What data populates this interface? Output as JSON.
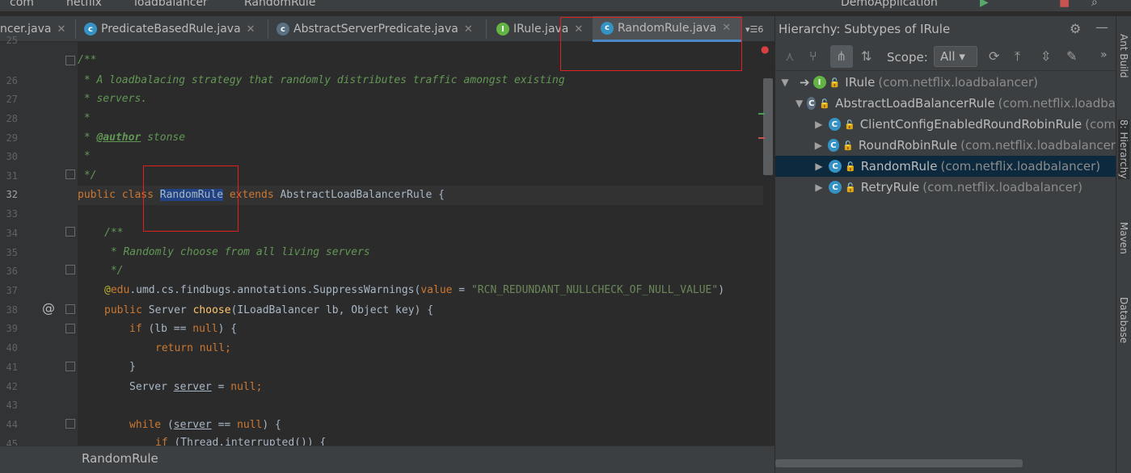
{
  "breadcrumbs": [
    "com",
    "netflix",
    "loadbalancer",
    "RandomRule"
  ],
  "run_config": "DemoApplication",
  "tabs": [
    {
      "label": "ncer.java",
      "icon": "class-icon"
    },
    {
      "label": "PredicateBasedRule.java",
      "icon": "class-icon"
    },
    {
      "label": "AbstractServerPredicate.java",
      "icon": "abstract-class-icon"
    },
    {
      "label": "IRule.java",
      "icon": "interface-icon"
    },
    {
      "label": "RandomRule.java",
      "icon": "class-icon",
      "active": true
    }
  ],
  "tab_overflow": "6",
  "editor": {
    "line_numbers": [
      "25",
      "26",
      "27",
      "28",
      "29",
      "30",
      "31",
      "32",
      "33",
      "34",
      "35",
      "36",
      "37",
      "38",
      "39",
      "40",
      "41",
      "42",
      "43",
      "44",
      "45"
    ],
    "lines": {
      "l25": "/**",
      "l26": " * A loadbalacing strategy that randomly distributes traffic amongst existing",
      "l27": " * servers.",
      "l28": " *",
      "l29_pre": " * ",
      "l29_tag": "@author",
      "l29_post": " stonse",
      "l30": " *",
      "l31": " */",
      "l32_kw": "public class ",
      "l32_name": "RandomRule",
      "l32_ext": " extends ",
      "l32_rest": "AbstractLoadBalancerRule {",
      "l34": "/**",
      "l35": " * Randomly choose from all living servers",
      "l36": " */",
      "l37_at": "@",
      "l37_edu": "edu",
      "l37_pkg": ".umd.cs.findbugs.annotations.SuppressWarnings(",
      "l37_val": "value",
      "l37_eq": " = ",
      "l37_str": "\"RCN_REDUNDANT_NULLCHECK_OF_NULL_VALUE\"",
      "l37_close": ")",
      "l38_kw": "public ",
      "l38_type": "Server ",
      "l38_fn": "choose",
      "l38_args": "(ILoadBalancer lb, Object key) {",
      "l39_kw": "if ",
      "l39_a": "(lb == ",
      "l39_null": "null",
      "l39_b": ") {",
      "l40_kw": "return ",
      "l40_null": "null",
      "l40_semi": ";",
      "l41": "}",
      "l42_a": "Server ",
      "l42_var": "server",
      "l42_b": " = ",
      "l42_null": "null",
      "l42_semi": ";",
      "l44_kw": "while ",
      "l44_a": "(",
      "l44_var": "server",
      "l44_b": " == ",
      "l44_null": "null",
      "l44_c": ") {",
      "l45_kw": "if ",
      "l45_a": "(Thread.interrupted()) {"
    }
  },
  "status_breadcrumb": "RandomRule",
  "hierarchy": {
    "title": "Hierarchy:  Subtypes of IRule",
    "scope_label": "Scope:",
    "scope_value": "All",
    "nodes": [
      {
        "name": "IRule",
        "pkg": "(com.netflix.loadbalancer)",
        "level": 0,
        "expanded": true
      },
      {
        "name": "AbstractLoadBalancerRule",
        "pkg": "(com.netflix.loadba",
        "level": 1,
        "expanded": true
      },
      {
        "name": "ClientConfigEnabledRoundRobinRule",
        "pkg": "(com",
        "level": 2
      },
      {
        "name": "RoundRobinRule",
        "pkg": "(com.netflix.loadbalancer",
        "level": 2
      },
      {
        "name": "RandomRule",
        "pkg": "(com.netflix.loadbalancer)",
        "level": 2,
        "selected": true
      },
      {
        "name": "RetryRule",
        "pkg": "(com.netflix.loadbalancer)",
        "level": 2
      }
    ]
  },
  "side_tools": [
    "Ant Build",
    "8: Hierarchy",
    "Maven",
    "Database"
  ]
}
